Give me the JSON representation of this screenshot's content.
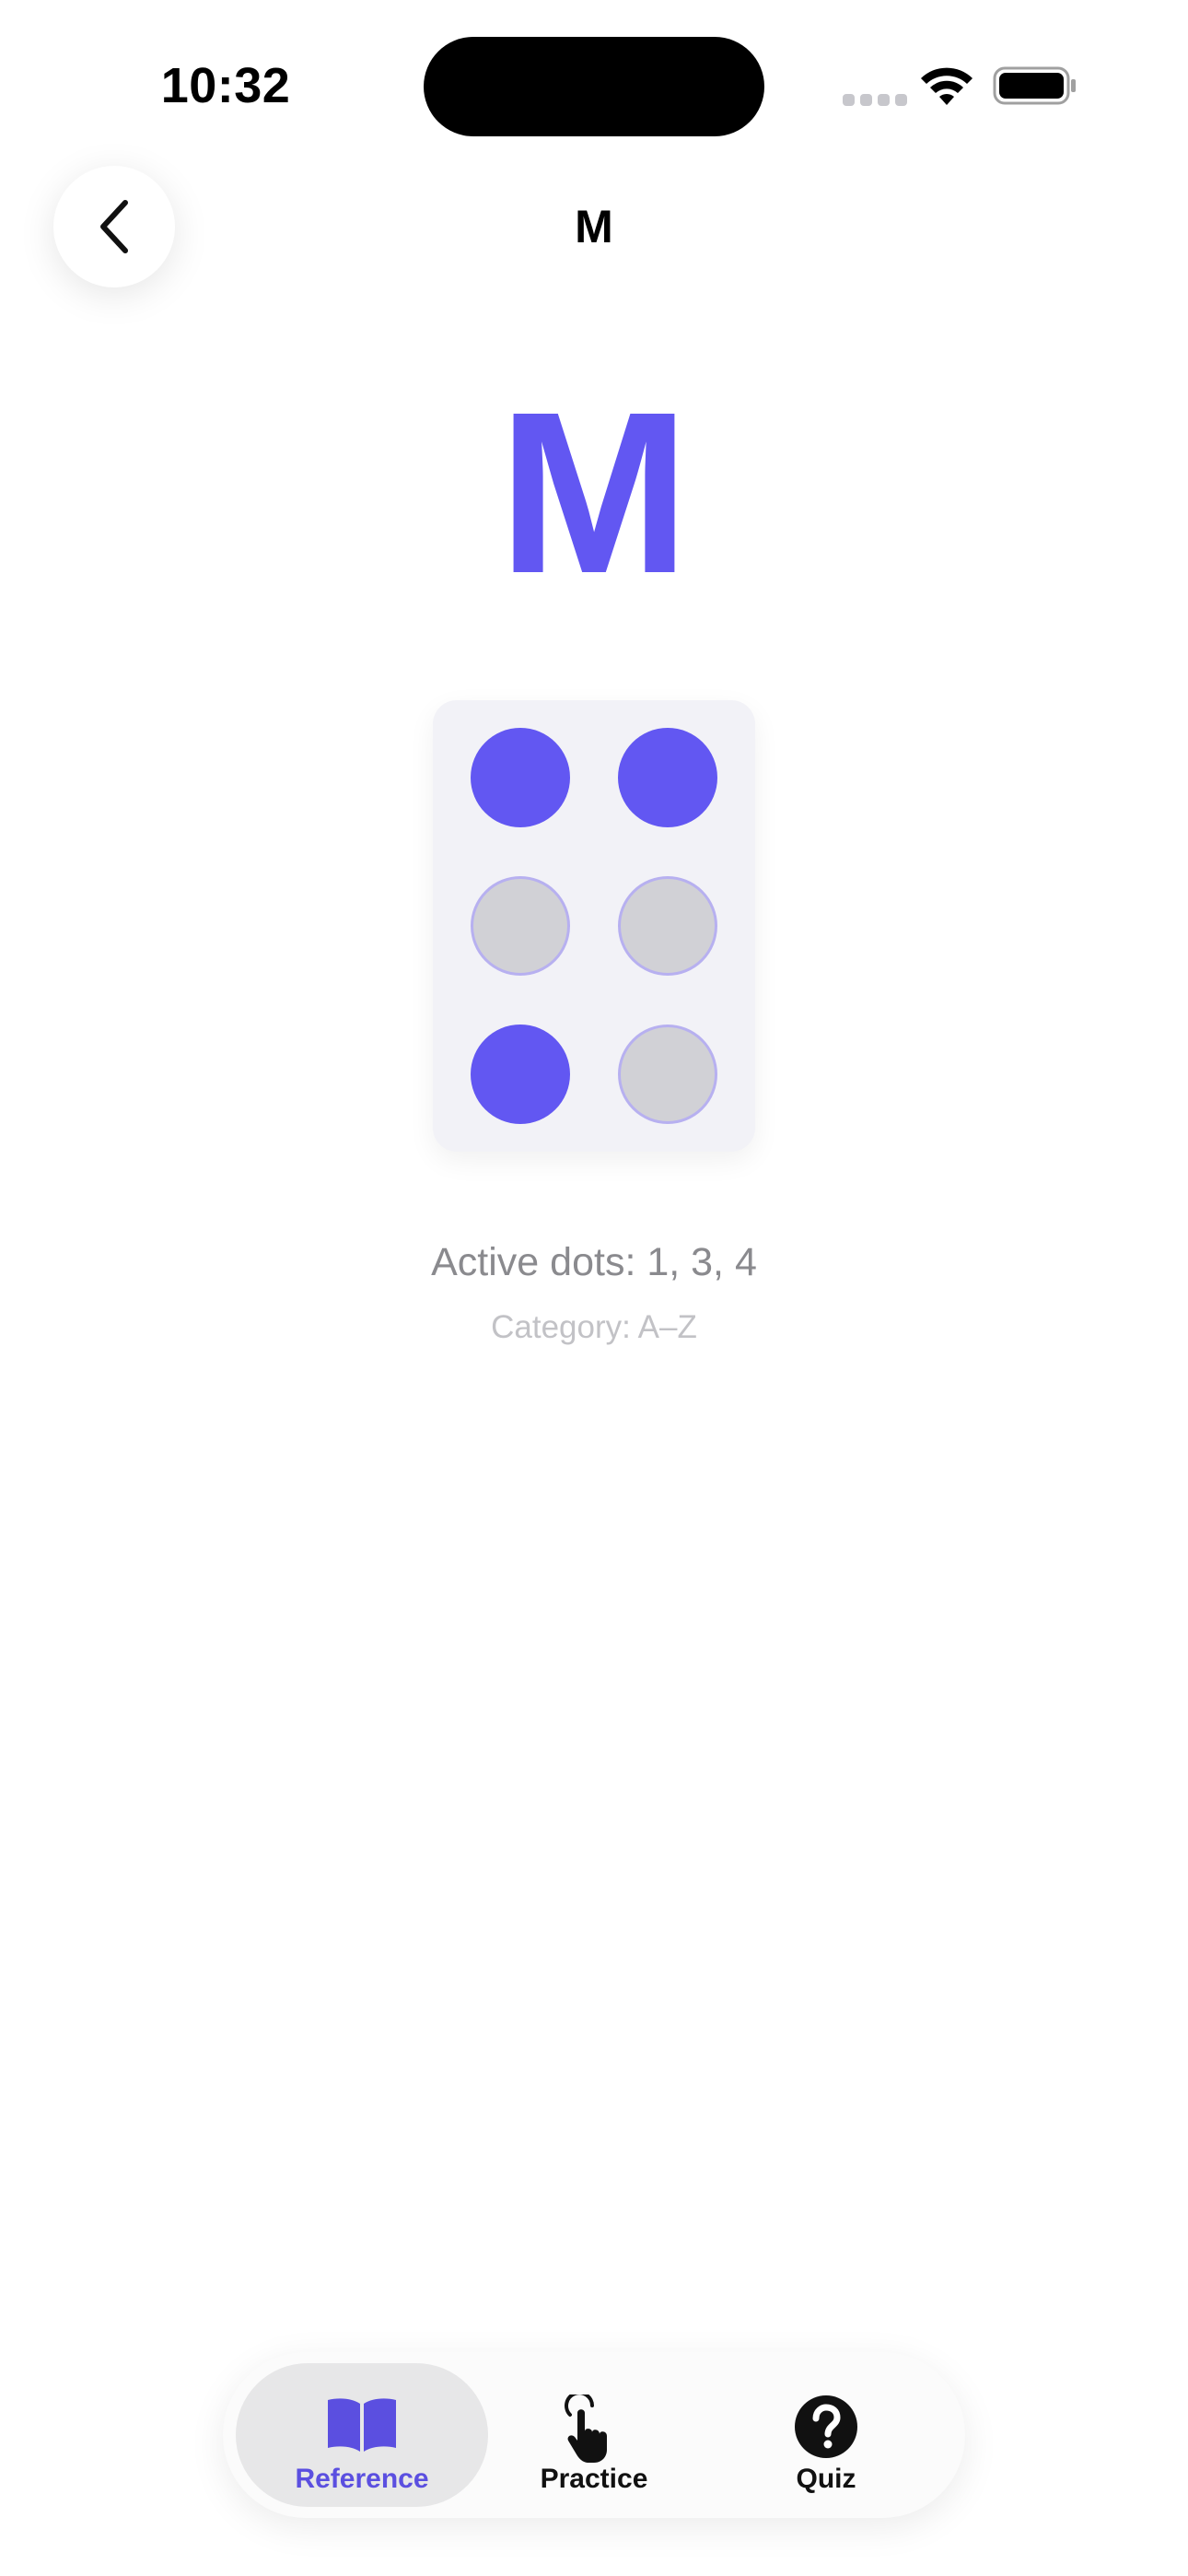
{
  "status_bar": {
    "time": "10:32",
    "icons": [
      "cellular-signal-icon",
      "wifi-icon",
      "battery-icon"
    ]
  },
  "navigation": {
    "back_icon": "chevron-left-icon",
    "title": "M"
  },
  "letter": {
    "character": "M",
    "color": "#6257F2"
  },
  "braille_cell": {
    "dots": [
      {
        "number": 1,
        "active": true
      },
      {
        "number": 4,
        "active": true
      },
      {
        "number": 2,
        "active": false
      },
      {
        "number": 5,
        "active": false
      },
      {
        "number": 3,
        "active": true
      },
      {
        "number": 6,
        "active": false
      }
    ],
    "active_color": "#6257F2",
    "inactive_color": "#D1D1D6"
  },
  "info": {
    "active_dots": "Active dots: 1, 3, 4",
    "category": "Category: A–Z"
  },
  "tab_bar": {
    "tabs": [
      {
        "label": "Reference",
        "icon": "book-icon",
        "selected": true
      },
      {
        "label": "Practice",
        "icon": "hand-tap-icon",
        "selected": false
      },
      {
        "label": "Quiz",
        "icon": "question-mark-circle-icon",
        "selected": false
      }
    ],
    "accent_color": "#5B4FE0"
  }
}
